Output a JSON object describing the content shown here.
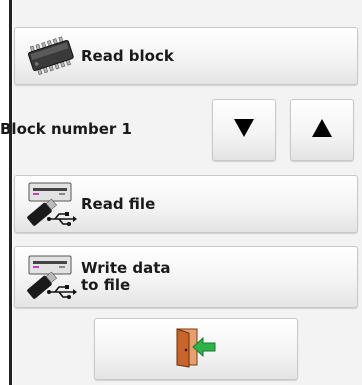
{
  "buttons": {
    "read_block": {
      "label": "Read block",
      "icon": "chip-icon"
    },
    "read_file": {
      "label": "Read file",
      "icon": "usb-drive-icon"
    },
    "write_file": {
      "label_line1": "Write data",
      "label_line2": "to file",
      "icon": "usb-drive-icon"
    },
    "exit": {
      "icon": "exit-door-icon"
    }
  },
  "block_selector": {
    "label": "Block number 1",
    "down_icon": "triangle-down-icon",
    "up_icon": "triangle-up-icon"
  },
  "colors": {
    "background": "#eeeeee",
    "button_border": "#c9c9c9",
    "exit_arrow": "#2fb24a",
    "door": "#c8652a"
  }
}
